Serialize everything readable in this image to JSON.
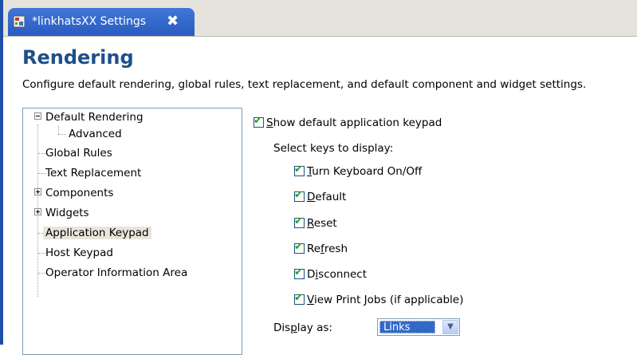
{
  "tab": {
    "title": "*linkhatsXX Settings",
    "icon": "settings-file-icon",
    "close_glyph": "✖"
  },
  "page": {
    "title": "Rendering",
    "description": "Configure default rendering, global rules, text replacement, and default component and widget settings."
  },
  "tree": {
    "items": [
      {
        "label": "Default Rendering",
        "expander": "collapse"
      },
      {
        "label": "Advanced"
      },
      {
        "label": "Global Rules"
      },
      {
        "label": "Text Replacement"
      },
      {
        "label": "Components",
        "expander": "expand"
      },
      {
        "label": "Widgets",
        "expander": "expand"
      },
      {
        "label": "Application Keypad",
        "selected": true
      },
      {
        "label": "Host Keypad"
      },
      {
        "label": "Operator Information Area"
      }
    ]
  },
  "keypad": {
    "show_label_pre": "",
    "show_label_access": "S",
    "show_label_post": "how default application keypad",
    "show_checked": true,
    "select_keys_label": "Select keys to display:",
    "keys": [
      {
        "pre": "",
        "access": "T",
        "post": "urn Keyboard On/Off",
        "checked": true
      },
      {
        "pre": "",
        "access": "D",
        "post": "efault",
        "checked": true
      },
      {
        "pre": "",
        "access": "R",
        "post": "eset",
        "checked": true
      },
      {
        "pre": "Re",
        "access": "f",
        "post": "resh",
        "checked": true
      },
      {
        "pre": "D",
        "access": "i",
        "post": "sconnect",
        "checked": true
      },
      {
        "pre": "",
        "access": "V",
        "post": "iew Print Jobs (if applicable)",
        "checked": true
      }
    ],
    "display_as_pre": "Dis",
    "display_as_access": "p",
    "display_as_post": "lay as:",
    "display_as_value": "Links"
  },
  "colors": {
    "tab_active": "#2a5bc0",
    "title": "#1d4f8a",
    "check_mark": "#21a121",
    "selection": "#316ac5"
  }
}
